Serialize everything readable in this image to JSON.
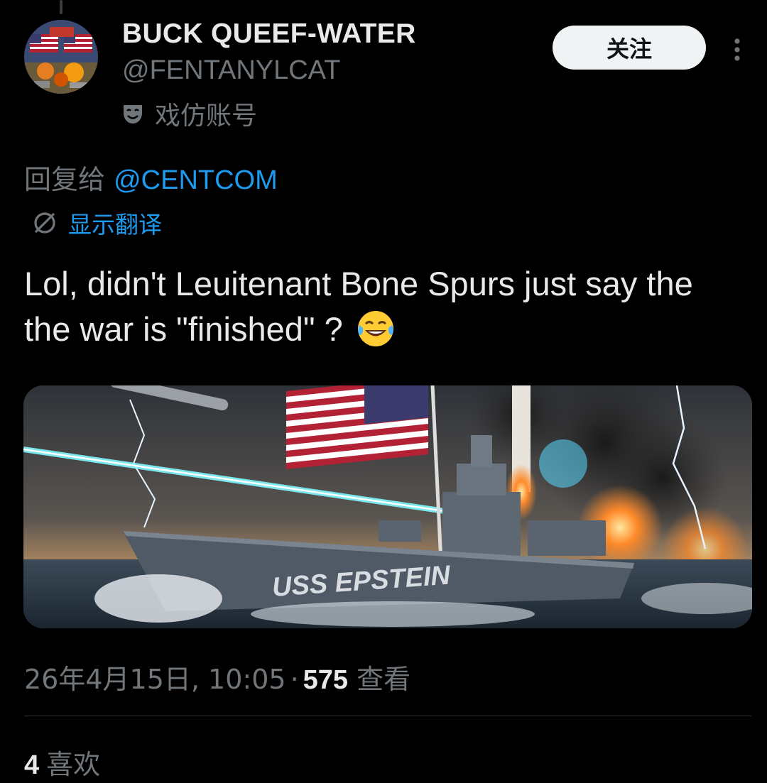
{
  "author": {
    "display_name": "BUCK QUEEF-WATER",
    "handle": "@FENTANYLCAT",
    "parody_label": "戏仿账号",
    "avatar_icon": "avatar-usa-collage"
  },
  "follow_label": "关注",
  "reply": {
    "prefix": "回复给 ",
    "mention": "@CENTCOM"
  },
  "translate_label": "显示翻译",
  "tweet_text": "Lol, didn't Leuitenant Bone Spurs just say the the war is \"finished\" ?",
  "tweet_emoji": "face-with-tears-of-joy",
  "media": {
    "ship_text": "USS EPSTEIN"
  },
  "meta": {
    "timestamp": "26年4月15日, 10:05",
    "separator": "·",
    "views_count": "575",
    "views_label": "查看"
  },
  "likes": {
    "count": "4",
    "label": "喜欢"
  },
  "colors": {
    "background": "#000000",
    "link": "#1d9bf0",
    "secondary_text": "#71767b",
    "primary_text": "#e7e9ea",
    "follow_button_bg": "#eff3f4"
  }
}
